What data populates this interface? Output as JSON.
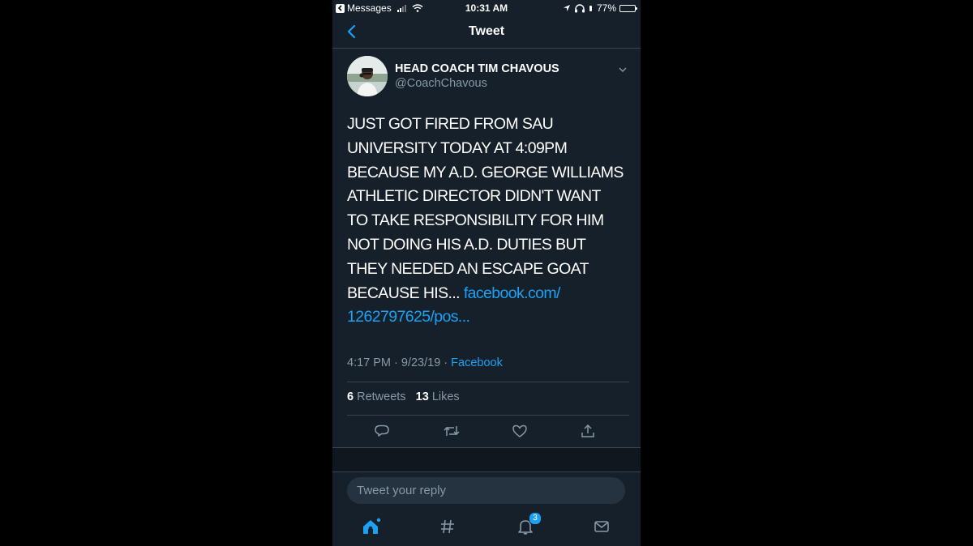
{
  "status_bar": {
    "back_app": "Messages",
    "time": "10:31 AM",
    "battery": "77%",
    "battery_level": 0.77
  },
  "nav": {
    "title": "Tweet"
  },
  "tweet": {
    "author_name": "HEAD COACH TIM CHAVOUS",
    "author_handle": "@CoachChavous",
    "text_lines": [
      "JUST GOT FIRED FROM SAU",
      "UNIVERSITY TODAY AT 4:09PM",
      "BECAUSE MY A.D. GEORGE WILLIAMS",
      "ATHLETIC DIRECTOR DIDN'T WANT",
      "TO TAKE RESPONSIBILITY FOR HIM",
      "NOT DOING HIS A.D. DUTIES BUT",
      "THEY NEEDED AN ESCAPE GOAT",
      "BECAUSE HIS..."
    ],
    "link_line1": "facebook.com/",
    "link_line2": "1262797625/pos...",
    "timestamp": "4:17 PM · 9/23/19 · ",
    "source": "Facebook",
    "retweets_count": "6",
    "retweets_label": "Retweets",
    "likes_count": "13",
    "likes_label": "Likes"
  },
  "reply": {
    "placeholder": "Tweet your reply"
  },
  "tabbar": {
    "notifications_badge": "3"
  },
  "colors": {
    "background": "#15202b",
    "accent": "#1da1f2",
    "secondary_text": "#8899a6",
    "divider": "#38444d"
  }
}
